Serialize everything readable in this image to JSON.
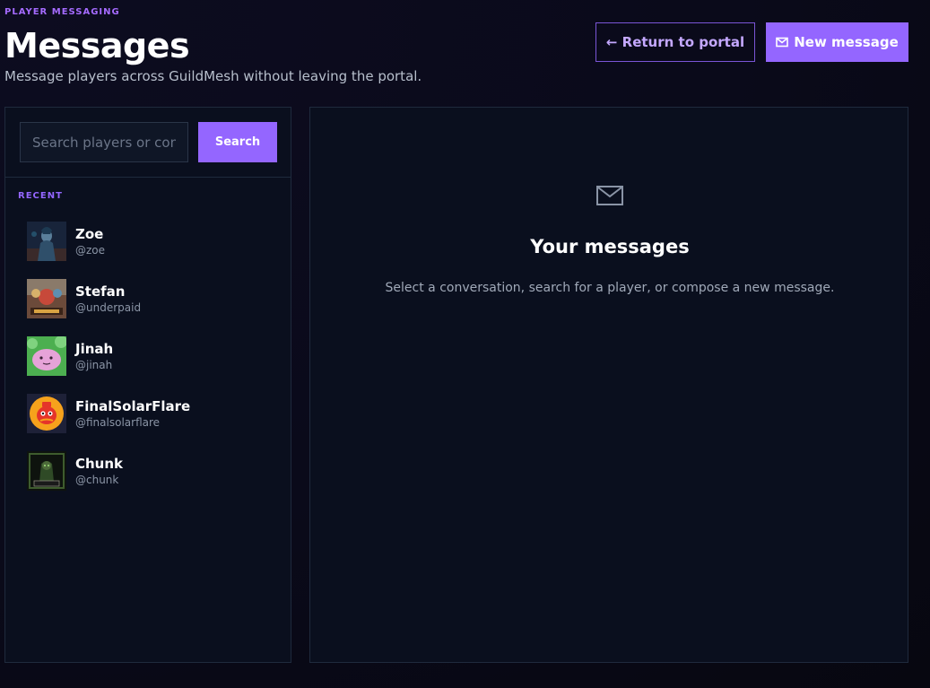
{
  "header": {
    "eyebrow": "PLAYER MESSAGING",
    "title": "Messages",
    "subtitle": "Message players across GuildMesh without leaving the portal.",
    "return_label": "← Return to portal",
    "new_message_label": "New message"
  },
  "search": {
    "placeholder": "Search players or conversations",
    "button_label": "Search"
  },
  "recent": {
    "label": "RECENT",
    "contacts": [
      {
        "name": "Zoe",
        "handle": "@zoe"
      },
      {
        "name": "Stefan",
        "handle": "@underpaid"
      },
      {
        "name": "Jinah",
        "handle": "@jinah"
      },
      {
        "name": "FinalSolarFlare",
        "handle": "@finalsolarflare"
      },
      {
        "name": "Chunk",
        "handle": "@chunk"
      }
    ]
  },
  "empty_state": {
    "icon": "mail-icon",
    "title": "Your messages",
    "description": "Select a conversation, search for a player, or compose a new message."
  },
  "colors": {
    "accent": "#9466ff",
    "eyebrow": "#a56bff",
    "panel": "#0a0f1e",
    "border": "#1f2a3d"
  }
}
